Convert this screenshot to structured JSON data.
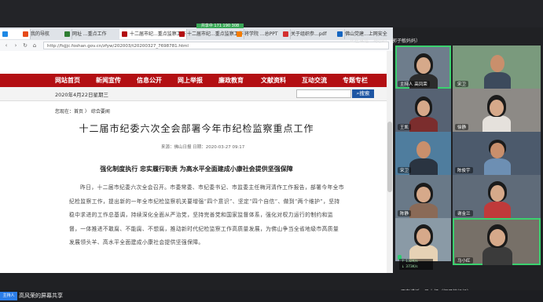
{
  "share_bar": {
    "label": "共享中 171 190 308"
  },
  "browser": {
    "tabs": [
      {
        "label": "我的导航",
        "color": "#e64a19"
      },
      {
        "label": "网址 ...重点工作",
        "color": "#2e7d32"
      },
      {
        "label": "十二届市纪...重点监察工作",
        "color": "#b30f13"
      },
      {
        "label": "十二届市纪...重点监察工作",
        "color": "#b30f13"
      },
      {
        "label": "将学院 ...总PPT",
        "color": "#f57c00"
      },
      {
        "label": "关于组织参...pdf",
        "color": "#d32f2f"
      },
      {
        "label": "佛山党建...上网安全",
        "color": "#1565c0"
      }
    ],
    "url": "http://fsjjjc.foshan.gov.cn/zfyw/202003/t20200327_7698781.html"
  },
  "site": {
    "nav": [
      "网站首页",
      "新闻宣传",
      "信息公开",
      "网上举报",
      "廉政教育",
      "文献资料",
      "互动交流",
      "专题专栏"
    ],
    "date": "2020年4月22日星期三",
    "search_button": "搜索"
  },
  "article": {
    "breadcrumb": "您现在：首页 〉 综合要闻",
    "title": "十二届市纪委六次全会部署今年市纪检监察重点工作",
    "meta": "来源：佛山日报   日期：2020-03-27 09:17",
    "subtitle": "强化制度执行  忠实履行职责  为高水平全面建成小康社会提供坚强保障",
    "body": "昨日，十二届市纪委六次全会召开。市委常委、市纪委书记、市监委主任梅河清作工作报告，部署今年全市纪检监察工作，提出新的一年全市纪检监察机关要增强“四个意识”、坚定“四个自信”、做到“两个维护”，坚持稳中求进的工作总基调，持续深化全面从严治党，坚持完善党和国家监督体系，强化对权力运行的制约和监督，一体推进不敢腐、不能腐、不想腐，推动新时代纪检监察工作高质量发展，为佛山争当全省地级市高质量发展领头羊、高水平全面建成小康社会提供坚强保障。"
  },
  "meeting": {
    "speaker_top": "正在讲话：马小红（郭子敏妈妈）",
    "speaker_bottom": "正在讲话：马小红（郭子敏妈妈）",
    "sharer": "高风荣的屏幕共享",
    "sharer_badge": "主持人",
    "participants": [
      {
        "name": "主持人 高凤荣",
        "icon": "person"
      },
      {
        "name": "宋卫",
        "icon": "person"
      },
      {
        "name": "王凯",
        "icon": "person"
      },
      {
        "name": "徐静",
        "icon": "person"
      },
      {
        "name": "宋卫",
        "icon": "person"
      },
      {
        "name": "陈俊宇",
        "icon": "person"
      },
      {
        "name": "陈静",
        "icon": "person"
      },
      {
        "name": "谢金兰",
        "icon": "person"
      },
      {
        "name": "",
        "icon": "person"
      },
      {
        "name": "马小红",
        "icon": "person"
      }
    ],
    "netstat": [
      "↑ 132K/s",
      "↓ 373K/s"
    ]
  },
  "colors": {
    "nav_red": "#b30f13",
    "search_blue": "#1e56a3",
    "active_speaker": "#3bd16f"
  }
}
